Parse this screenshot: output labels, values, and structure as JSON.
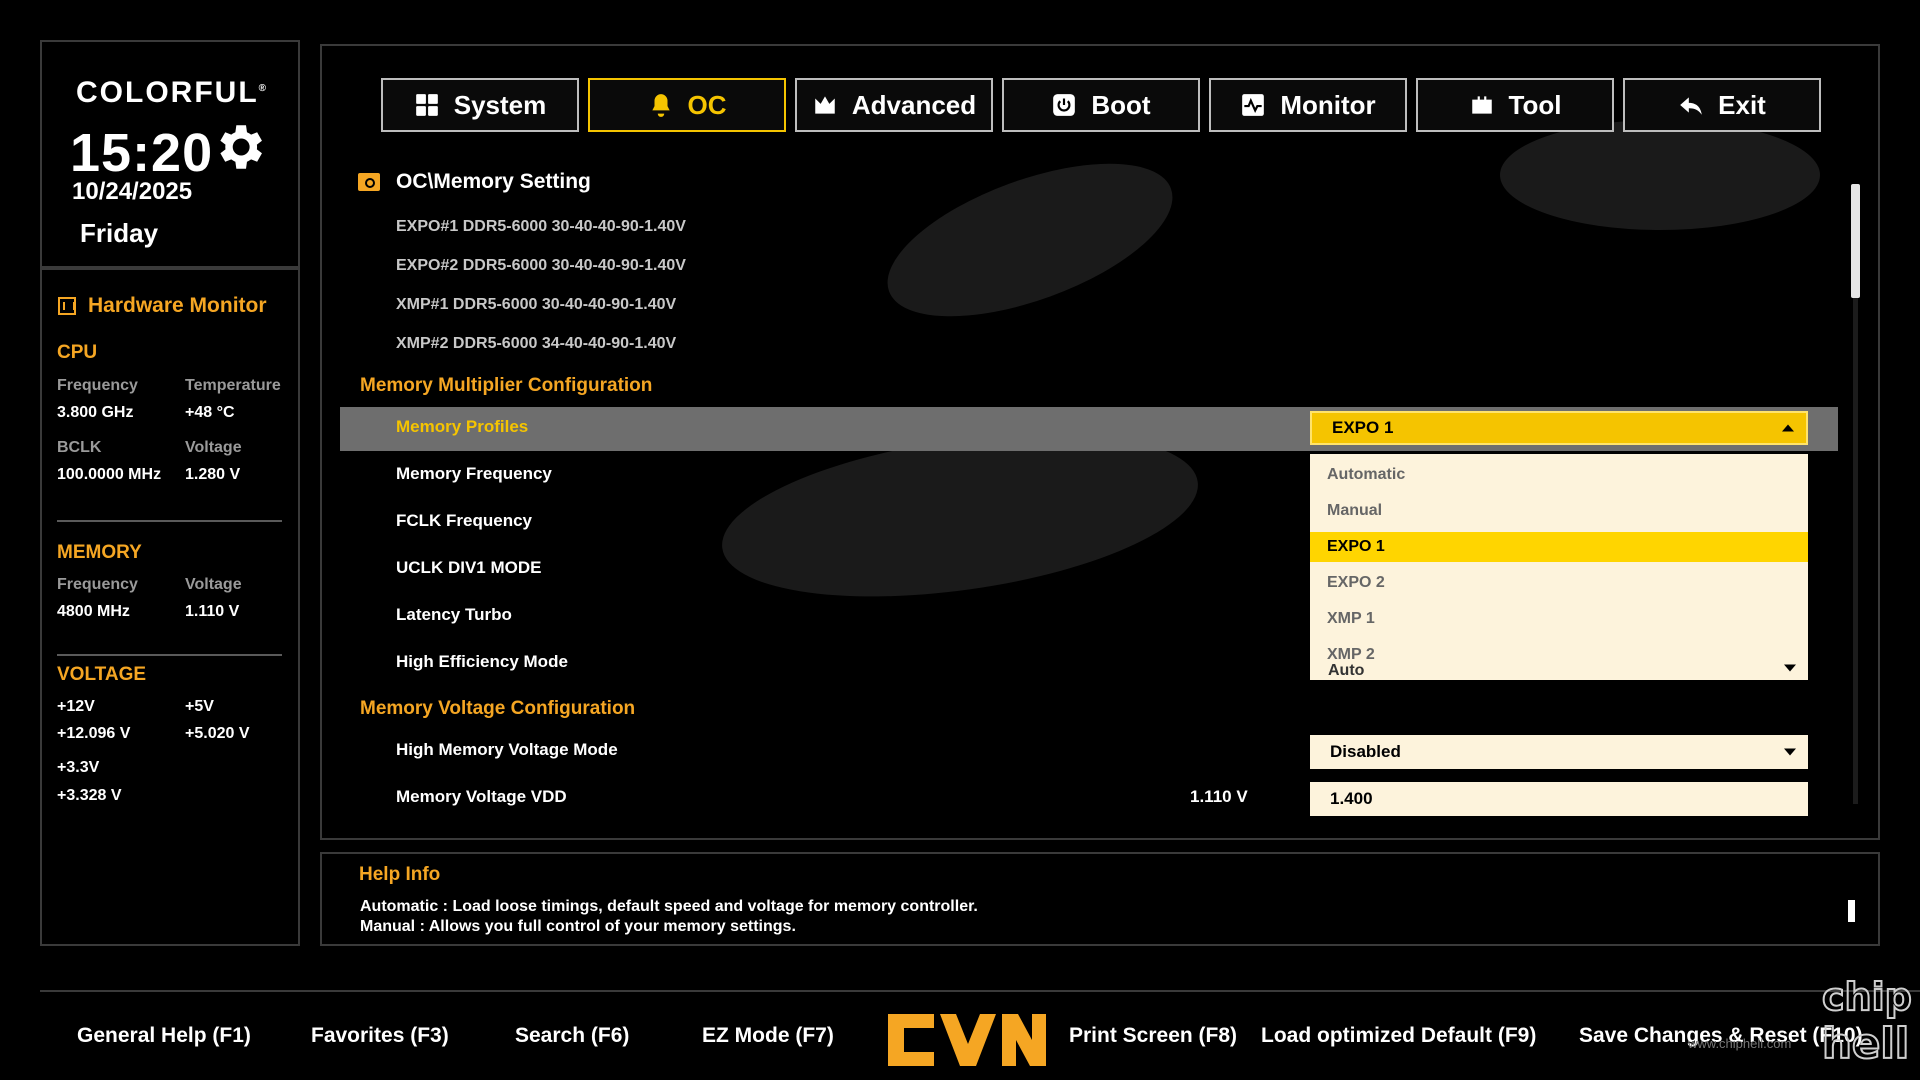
{
  "brand": {
    "name": "COLORFUL",
    "mark": "®"
  },
  "clock": {
    "time": "15:20",
    "date": "10/24/2025",
    "weekday": "Friday"
  },
  "hardware_monitor": {
    "title": "Hardware Monitor",
    "cpu": {
      "title": "CPU",
      "frequency_label": "Frequency",
      "frequency": "3.800 GHz",
      "temperature_label": "Temperature",
      "temperature": "+48 °C",
      "bclk_label": "BCLK",
      "bclk": "100.0000 MHz",
      "voltage_label": "Voltage",
      "voltage": "1.280 V"
    },
    "memory": {
      "title": "MEMORY",
      "frequency_label": "Frequency",
      "frequency": "4800 MHz",
      "voltage_label": "Voltage",
      "voltage": "1.110 V"
    },
    "voltage": {
      "title": "VOLTAGE",
      "v12_label": "+12V",
      "v12": "+12.096 V",
      "v5_label": "+5V",
      "v5": "+5.020 V",
      "v33_label": "+3.3V",
      "v33": "+3.328 V"
    }
  },
  "tabs": [
    {
      "label": "System",
      "icon": "grid-icon",
      "active": false
    },
    {
      "label": "OC",
      "icon": "bell-icon",
      "active": true
    },
    {
      "label": "Advanced",
      "icon": "crown-icon",
      "active": false
    },
    {
      "label": "Boot",
      "icon": "power-icon",
      "active": false
    },
    {
      "label": "Monitor",
      "icon": "pulse-icon",
      "active": false
    },
    {
      "label": "Tool",
      "icon": "toolbox-icon",
      "active": false
    },
    {
      "label": "Exit",
      "icon": "back-arrow-icon",
      "active": false
    }
  ],
  "breadcrumb": "OC\\Memory Setting",
  "profiles_info": [
    "EXPO#1 DDR5-6000 30-40-40-90-1.40V",
    "EXPO#2 DDR5-6000 30-40-40-90-1.40V",
    "XMP#1   DDR5-6000 30-40-40-90-1.40V",
    "XMP#2   DDR5-6000 34-40-40-90-1.40V"
  ],
  "multiplier_group": {
    "title": "Memory Multiplier Configuration",
    "rows": [
      {
        "label": "Memory Profiles",
        "value": "EXPO 1"
      },
      {
        "label": "Memory Frequency"
      },
      {
        "label": "FCLK Frequency"
      },
      {
        "label": "UCLK DIV1 MODE"
      },
      {
        "label": "Latency Turbo"
      },
      {
        "label": "High Efficiency Mode",
        "value": "Auto"
      }
    ]
  },
  "dropdown": {
    "options": [
      "Automatic",
      "Manual",
      "EXPO 1",
      "EXPO 2",
      "XMP 1",
      "XMP 2"
    ],
    "selected": "EXPO 1"
  },
  "voltage_group": {
    "title": "Memory Voltage Configuration",
    "rows": [
      {
        "label": "High Memory Voltage Mode",
        "value": "Disabled"
      },
      {
        "label": "Memory Voltage VDD",
        "current": "1.110 V",
        "value": "1.400"
      }
    ]
  },
  "help": {
    "title": "Help Info",
    "lines": [
      "Automatic : Load loose timings, default speed and voltage for memory controller.",
      "Manual : Allows you full control of your memory settings."
    ]
  },
  "footer": [
    "General Help (F1)",
    "Favorites (F3)",
    "Search (F6)",
    "EZ Mode (F7)",
    "Print Screen (F8)",
    "Load optimized Default (F9)",
    "Save Changes & Reset (F10)"
  ],
  "watermark": {
    "text": "www.chiphell.com",
    "logo": "chip hell"
  },
  "colors": {
    "accent_orange": "#f5a623",
    "accent_yellow": "#f5c400",
    "field_bg": "#fdf3dc",
    "row_highlight": "#6e6e6e",
    "background": "#000000"
  }
}
